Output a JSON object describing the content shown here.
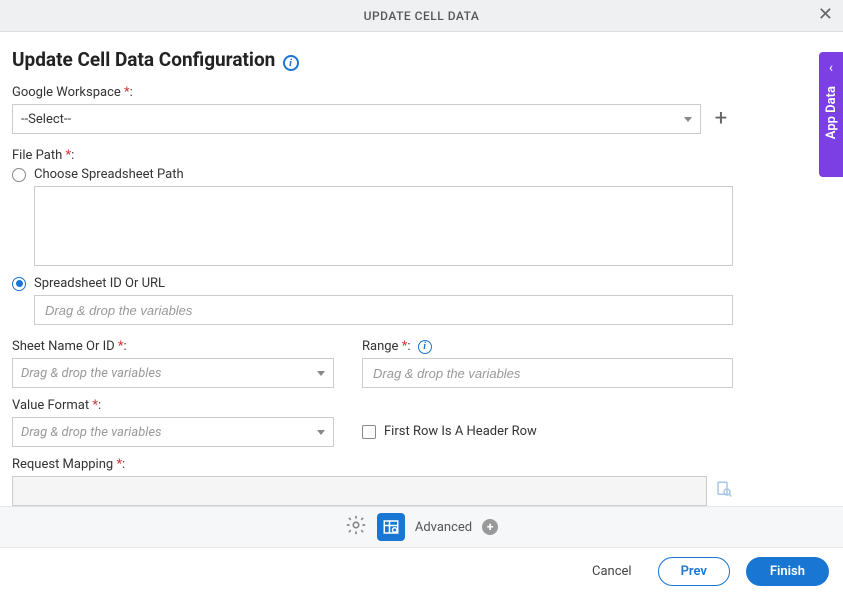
{
  "header": {
    "title": "UPDATE CELL DATA"
  },
  "side_panel": {
    "label": "App Data"
  },
  "page": {
    "title": "Update Cell Data Configuration"
  },
  "fields": {
    "google_workspace": {
      "label": "Google Workspace",
      "value": "--Select--"
    },
    "file_path": {
      "label": "File Path",
      "option_choose": "Choose Spreadsheet Path",
      "option_id_url": "Spreadsheet ID Or URL",
      "id_url_placeholder": "Drag & drop the variables"
    },
    "sheet_name": {
      "label": "Sheet Name Or ID",
      "placeholder": "Drag & drop the variables"
    },
    "range": {
      "label": "Range",
      "placeholder": "Drag & drop the variables"
    },
    "value_format": {
      "label": "Value Format",
      "placeholder": "Drag & drop the variables"
    },
    "first_row_header": {
      "label": "First Row Is A Header Row"
    },
    "request_mapping": {
      "label": "Request Mapping"
    }
  },
  "toolbar": {
    "advanced": "Advanced"
  },
  "footer": {
    "cancel": "Cancel",
    "prev": "Prev",
    "finish": "Finish"
  }
}
